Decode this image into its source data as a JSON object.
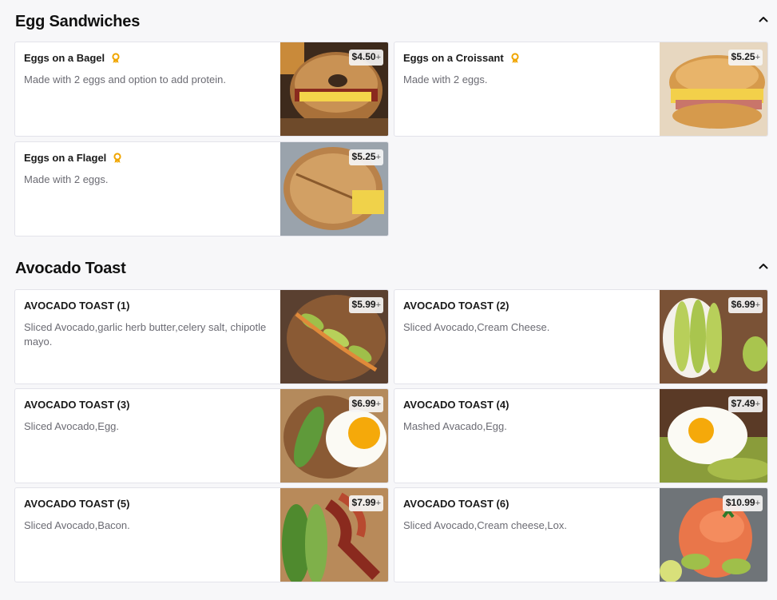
{
  "sections": [
    {
      "title": "Egg Sandwiches",
      "items": [
        {
          "name": "Eggs on a Bagel",
          "description": "Made with 2 eggs and option to add protein.",
          "price": "$4.50",
          "plus": "+",
          "popular": true
        },
        {
          "name": "Eggs on a Croissant",
          "description": "Made with 2 eggs.",
          "price": "$5.25",
          "plus": "+",
          "popular": true
        },
        {
          "name": "Eggs on a Flagel",
          "description": "Made with 2 eggs.",
          "price": "$5.25",
          "plus": "+",
          "popular": true
        }
      ]
    },
    {
      "title": "Avocado Toast",
      "items": [
        {
          "name": "AVOCADO TOAST (1)",
          "description": "Sliced Avocado,garlic herb butter,celery salt, chipotle mayo.",
          "price": "$5.99",
          "plus": "+"
        },
        {
          "name": "AVOCADO TOAST (2)",
          "description": "Sliced Avocado,Cream Cheese.",
          "price": "$6.99",
          "plus": "+"
        },
        {
          "name": "AVOCADO TOAST (3)",
          "description": "Sliced Avocado,Egg.",
          "price": "$6.99",
          "plus": "+"
        },
        {
          "name": "AVOCADO TOAST (4)",
          "description": "Mashed Avacado,Egg.",
          "price": "$7.49",
          "plus": "+"
        },
        {
          "name": "AVOCADO TOAST (5)",
          "description": "Sliced Avocado,Bacon.",
          "price": "$7.99",
          "plus": "+"
        },
        {
          "name": "AVOCADO TOAST (6)",
          "description": "Sliced Avocado,Cream cheese,Lox.",
          "price": "$10.99",
          "plus": "+"
        }
      ]
    }
  ],
  "colors": {
    "badge": "#f0a500",
    "background": "#f7f7f9",
    "card_border": "#e3e3ea"
  },
  "icons": {
    "collapse": "chevron-up-icon",
    "popular": "award-ribbon-icon"
  }
}
